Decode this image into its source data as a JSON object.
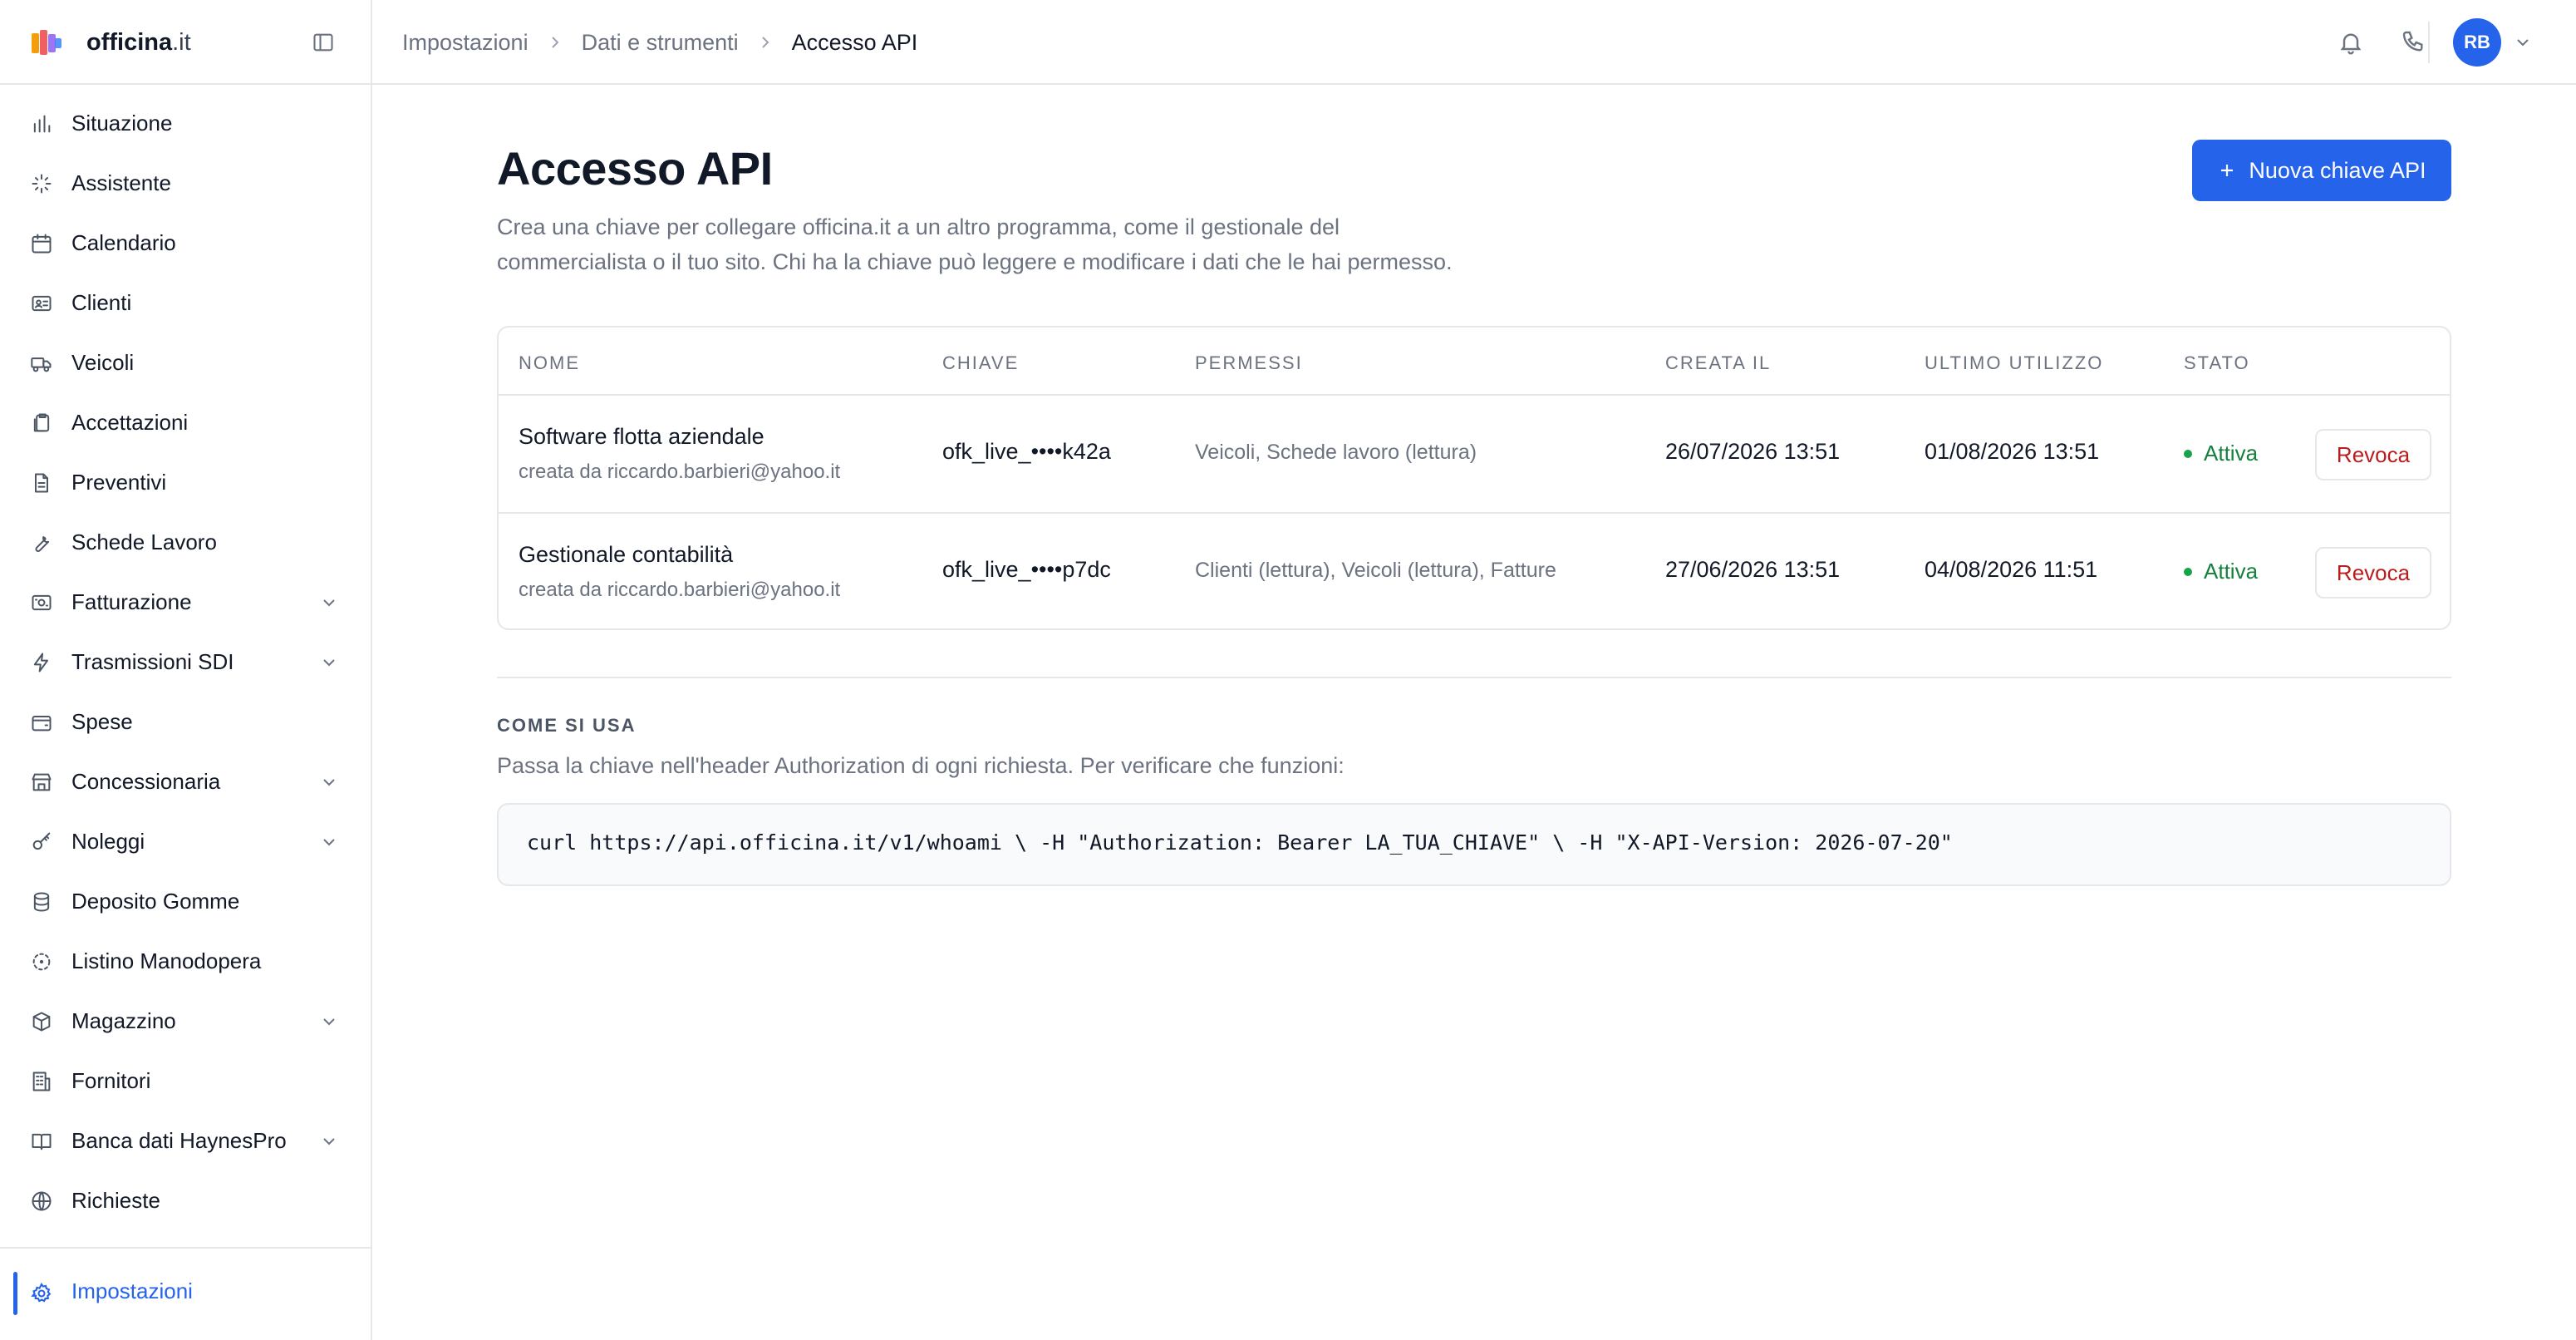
{
  "brand": {
    "name_bold": "officina",
    "name_rest": ".it"
  },
  "sidebar": {
    "items": [
      {
        "label": "Situazione",
        "icon": "bar-chart-icon",
        "has_chevron": false
      },
      {
        "label": "Assistente",
        "icon": "sparkles-icon",
        "has_chevron": false
      },
      {
        "label": "Calendario",
        "icon": "calendar-icon",
        "has_chevron": false
      },
      {
        "label": "Clienti",
        "icon": "id-card-icon",
        "has_chevron": false
      },
      {
        "label": "Veicoli",
        "icon": "truck-icon",
        "has_chevron": false
      },
      {
        "label": "Accettazioni",
        "icon": "clipboard-copy-icon",
        "has_chevron": false
      },
      {
        "label": "Preventivi",
        "icon": "document-icon",
        "has_chevron": false
      },
      {
        "label": "Schede Lavoro",
        "icon": "wrench-icon",
        "has_chevron": false
      },
      {
        "label": "Fatturazione",
        "icon": "receipt-icon",
        "has_chevron": true
      },
      {
        "label": "Trasmissioni SDI",
        "icon": "lightning-icon",
        "has_chevron": true
      },
      {
        "label": "Spese",
        "icon": "wallet-icon",
        "has_chevron": false
      },
      {
        "label": "Concessionaria",
        "icon": "store-icon",
        "has_chevron": true
      },
      {
        "label": "Noleggi",
        "icon": "key-icon",
        "has_chevron": true
      },
      {
        "label": "Deposito Gomme",
        "icon": "database-icon",
        "has_chevron": false
      },
      {
        "label": "Listino Manodopera",
        "icon": "dashed-circle-icon",
        "has_chevron": false
      },
      {
        "label": "Magazzino",
        "icon": "box-icon",
        "has_chevron": true
      },
      {
        "label": "Fornitori",
        "icon": "building-icon",
        "has_chevron": false
      },
      {
        "label": "Banca dati HaynesPro",
        "icon": "book-icon",
        "has_chevron": true
      },
      {
        "label": "Richieste",
        "icon": "globe-icon",
        "has_chevron": false
      }
    ],
    "bottom_item": {
      "label": "Impostazioni",
      "icon": "gear-icon",
      "active": true
    }
  },
  "topbar": {
    "breadcrumbs": [
      "Impostazioni",
      "Dati e strumenti",
      "Accesso API"
    ],
    "avatar_initials": "RB"
  },
  "main": {
    "title": "Accesso API",
    "description_line1": "Crea una chiave per collegare officina.it a un altro programma, come il gestionale del",
    "description_line2": "commercialista o il tuo sito. Chi ha la chiave può leggere e modificare i dati che le hai permesso.",
    "new_key_button": "Nuova chiave API",
    "table": {
      "headers": [
        "NOME",
        "CHIAVE",
        "PERMESSI",
        "CREATA IL",
        "ULTIMO UTILIZZO",
        "STATO"
      ],
      "rows": [
        {
          "name": "Software flotta aziendale",
          "created_by": "creata da riccardo.barbieri@yahoo.it",
          "key": "ofk_live_••••k42a",
          "permissions": "Veicoli, Schede lavoro (lettura)",
          "created_at": "26/07/2026 13:51",
          "last_used": "01/08/2026 13:51",
          "status": "Attiva",
          "action": "Revoca"
        },
        {
          "name": "Gestionale contabilità",
          "created_by": "creata da riccardo.barbieri@yahoo.it",
          "key": "ofk_live_••••p7dc",
          "permissions": "Clienti (lettura), Veicoli (lettura), Fatture",
          "created_at": "27/06/2026 13:51",
          "last_used": "04/08/2026 11:51",
          "status": "Attiva",
          "action": "Revoca"
        }
      ]
    },
    "how_to": {
      "title": "COME SI USA",
      "description": "Passa la chiave nell'header Authorization di ogni richiesta. Per verificare che funzioni:",
      "code": "curl https://api.officina.it/v1/whoami \\ -H \"Authorization: Bearer LA_TUA_CHIAVE\" \\ -H \"X-API-Version: 2026-07-20\""
    }
  },
  "colors": {
    "accent": "#2563eb",
    "status_active": "#15803d",
    "danger": "#b91c1c",
    "muted_text": "#6b7280",
    "border": "#e5e7eb"
  }
}
